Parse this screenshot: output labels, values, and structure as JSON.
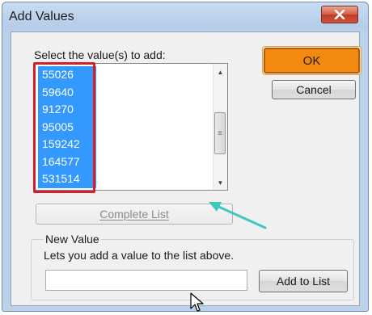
{
  "window": {
    "title": "Add Values",
    "close_icon": "close-icon"
  },
  "list": {
    "label": "Select the value(s) to add:",
    "items": [
      "55026",
      "59640",
      "91270",
      "95005",
      "159242",
      "164577",
      "531514"
    ],
    "selected_all": true
  },
  "buttons": {
    "ok": "OK",
    "cancel": "Cancel",
    "complete_list": "Complete List",
    "add_to_list": "Add to List"
  },
  "new_value": {
    "group_label": "New Value",
    "description": "Lets you add a value to the list above.",
    "input_value": ""
  },
  "colors": {
    "selection": "#3399ff",
    "highlight_box": "#d21f2a",
    "ok_button": "#f28a12",
    "annotation_arrow": "#3fc7c0"
  }
}
